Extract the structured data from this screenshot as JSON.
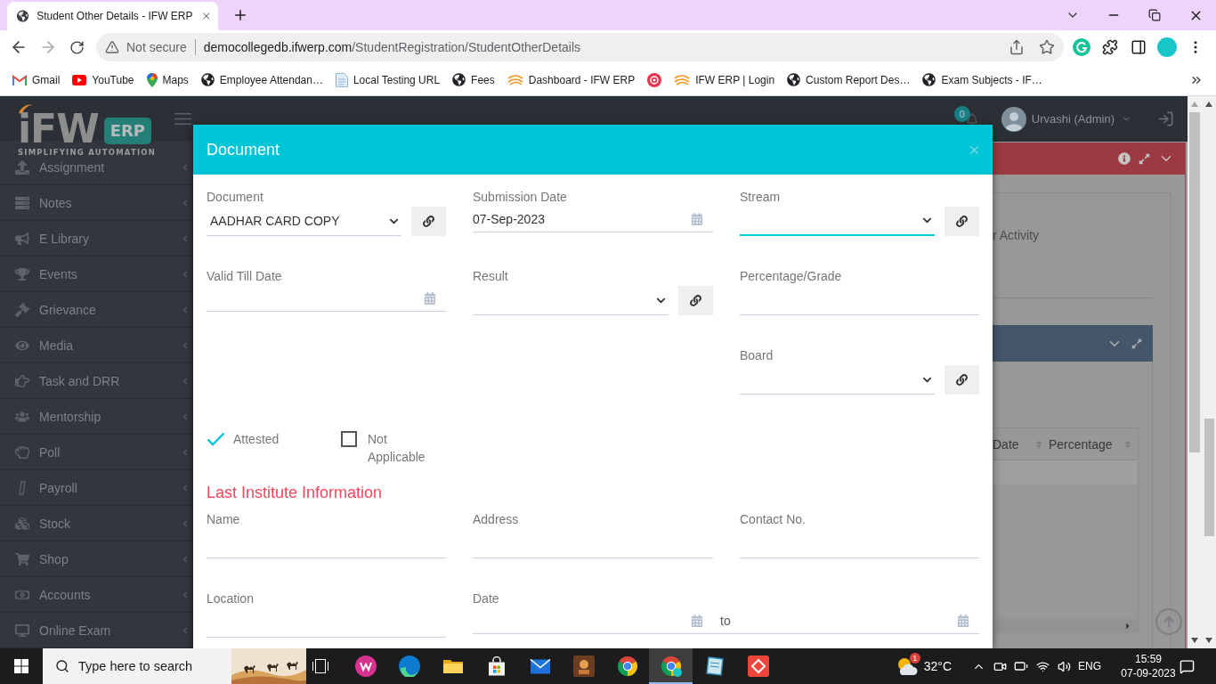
{
  "browser": {
    "tabs": [
      {
        "title": "Student Other Details - IFW ERP",
        "selected": true
      }
    ],
    "address_bar": {
      "security": "Not secure",
      "domain": "democollegedb.ifwerp.com",
      "path": "/StudentRegistration/StudentOtherDetails"
    },
    "bookmarks": [
      {
        "kind": "link",
        "label": "Gmail"
      },
      {
        "kind": "link",
        "label": "YouTube"
      },
      {
        "kind": "link",
        "label": "Maps"
      },
      {
        "kind": "link",
        "label": "Employee Attendan…"
      },
      {
        "kind": "link",
        "label": "Local Testing URL"
      },
      {
        "kind": "link",
        "label": "Fees"
      },
      {
        "kind": "link",
        "label": "Dashboard - IFW ERP"
      },
      {
        "kind": "icon"
      },
      {
        "kind": "link",
        "label": "IFW ERP | Login"
      },
      {
        "kind": "link",
        "label": "Custom Report Des…"
      },
      {
        "kind": "link",
        "label": "Exam Subjects - IF…"
      }
    ]
  },
  "app": {
    "logo": {
      "mark": "iFW",
      "badge": "ERP",
      "tagline": "SIMPLIFYING AUTOMATION"
    },
    "header": {
      "notification_count": "0",
      "user": "Urvashi (Admin)"
    },
    "sidebar": {
      "items": [
        {
          "label": "Assignment"
        },
        {
          "label": "Notes"
        },
        {
          "label": "E Library"
        },
        {
          "label": "Events"
        },
        {
          "label": "Grievance"
        },
        {
          "label": "Media"
        },
        {
          "label": "Task and DRR"
        },
        {
          "label": "Mentorship"
        },
        {
          "label": "Poll"
        },
        {
          "label": "Payroll"
        },
        {
          "label": "Stock"
        },
        {
          "label": "Shop"
        },
        {
          "label": "Accounts"
        },
        {
          "label": "Online Exam"
        }
      ]
    },
    "content": {
      "panel_text": "r Activity",
      "table": {
        "columns": [
          "Date",
          "Percentage"
        ]
      }
    }
  },
  "modal": {
    "title": "Document",
    "rows": [
      [
        {
          "kind": "select",
          "label": "Document",
          "value": "AADHAR CARD COPY",
          "link_button": true,
          "focused": false
        },
        {
          "kind": "date",
          "label": "Submission Date",
          "value": "07-Sep-2023",
          "focused": false
        },
        {
          "kind": "select",
          "label": "Stream",
          "link_button": true,
          "focused": true
        }
      ],
      [
        {
          "kind": "date",
          "label": "Valid Till Date",
          "focused": false
        },
        {
          "kind": "select",
          "label": "Result",
          "link_button": true,
          "focused": false
        },
        {
          "kind": "text",
          "label": "Percentage/Grade",
          "focused": false
        }
      ],
      [
        null,
        null,
        {
          "kind": "select",
          "label": "Board",
          "link_button": true,
          "focused": false
        }
      ]
    ],
    "checkboxes": [
      {
        "label": "Attested",
        "checked": true
      },
      {
        "label": "Not Applicable",
        "checked": false
      }
    ],
    "section": {
      "title": "Last Institute Information",
      "rows": [
        [
          {
            "kind": "text",
            "label": "Name",
            "focused": false
          },
          {
            "kind": "text",
            "label": "Address",
            "focused": false
          },
          {
            "kind": "text",
            "label": "Contact No.",
            "focused": false
          }
        ],
        [
          {
            "kind": "text",
            "label": "Location",
            "focused": false
          },
          {
            "kind": "date_range",
            "label": "Date",
            "separator": "to",
            "focused": false
          }
        ]
      ]
    }
  },
  "taskbar": {
    "search": {
      "placeholder": "Type here to search"
    },
    "apps": [
      {
        "selected": false
      },
      {
        "selected": false
      },
      {
        "selected": false
      },
      {
        "selected": false
      },
      {
        "selected": false
      },
      {
        "selected": false
      },
      {
        "selected": false
      },
      {
        "selected": true
      },
      {
        "selected": false
      },
      {
        "selected": false
      }
    ],
    "weather": {
      "badge": "1",
      "temperature": "32°C"
    },
    "language": "ENG",
    "clock": {
      "time": "15:59",
      "date": "07-09-2023"
    }
  }
}
